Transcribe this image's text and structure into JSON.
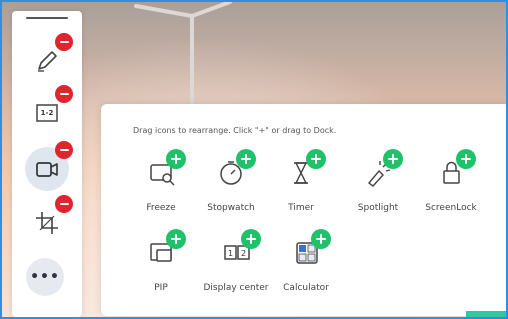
{
  "panel": {
    "hint": "Drag icons to rearrange. Click \"+\" or drag to Dock."
  },
  "tools": [
    {
      "label": "Freeze",
      "icon": "freeze-icon"
    },
    {
      "label": "Stopwatch",
      "icon": "stopwatch-icon"
    },
    {
      "label": "Timer",
      "icon": "timer-icon"
    },
    {
      "label": "Spotlight",
      "icon": "spotlight-icon"
    },
    {
      "label": "ScreenLock",
      "icon": "screenlock-icon"
    },
    {
      "label": "PIP",
      "icon": "pip-icon"
    },
    {
      "label": "Display center",
      "icon": "display-center-icon"
    },
    {
      "label": "Calculator",
      "icon": "calculator-icon"
    }
  ],
  "dock": {
    "items": [
      {
        "name": "pen",
        "icon": "pen-icon"
      },
      {
        "name": "number-tool",
        "icon": "one-two-icon",
        "text": "1-2"
      },
      {
        "name": "screen-record",
        "icon": "camera-icon"
      },
      {
        "name": "crop",
        "icon": "crop-icon"
      }
    ],
    "more_label": "•••"
  },
  "colors": {
    "accent_blue": "#2f8fe6",
    "remove_red": "#e0252e",
    "add_green": "#1fc26a"
  }
}
